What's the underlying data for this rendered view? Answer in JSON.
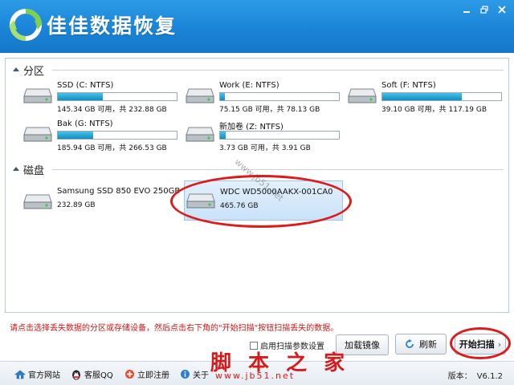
{
  "app": {
    "title": "佳佳数据恢复"
  },
  "sections": {
    "partitions": "分区",
    "disks": "磁盘"
  },
  "partitions": [
    {
      "name": "SSD (C: NTFS)",
      "capacity": "145.34 GB 可用，共 232.88 GB",
      "used_fraction": 0.38
    },
    {
      "name": "Work (E: NTFS)",
      "capacity": "75.15 GB 可用，共 78.13 GB",
      "used_fraction": 0.04
    },
    {
      "name": "Soft (F: NTFS)",
      "capacity": "39.10 GB 可用，共 117.19 GB",
      "used_fraction": 0.67
    },
    {
      "name": "Bak (G: NTFS)",
      "capacity": "185.94 GB 可用，共 266.53 GB",
      "used_fraction": 0.3
    },
    {
      "name": "新加卷 (Z: NTFS)",
      "capacity": "3.73 GB 可用，共 3.91 GB",
      "used_fraction": 0.05
    }
  ],
  "disks": [
    {
      "name": "Samsung SSD 850 EVO 250GB",
      "size": "232.89 GB"
    },
    {
      "name": "WDC WD5000AAKX-001CA0",
      "size": "465.76 GB"
    }
  ],
  "hint": "请点击选择丢失数据的分区或存储设备，然后点击右下角的\"开始扫描\"按钮扫描丢失的数据。",
  "actions": {
    "scan_params_label": "启用扫描参数设置",
    "load_image": "加载镜像",
    "refresh": "刷新",
    "start_scan": "开始扫描"
  },
  "footer": {
    "website": "官方网站",
    "support": "客服QQ",
    "register": "立即注册",
    "about": "关于",
    "version_label": "版本：",
    "version": "V6.1.2"
  },
  "watermark": {
    "brand": "脚 本 之 家",
    "url": "www.jb51.net",
    "diagonal": "www.jb51.net"
  },
  "colors": {
    "title_bar": "#1a84d6",
    "bar_fill": "#0f8ec3",
    "highlight": "#dc1c1c",
    "hint": "#d21515"
  }
}
